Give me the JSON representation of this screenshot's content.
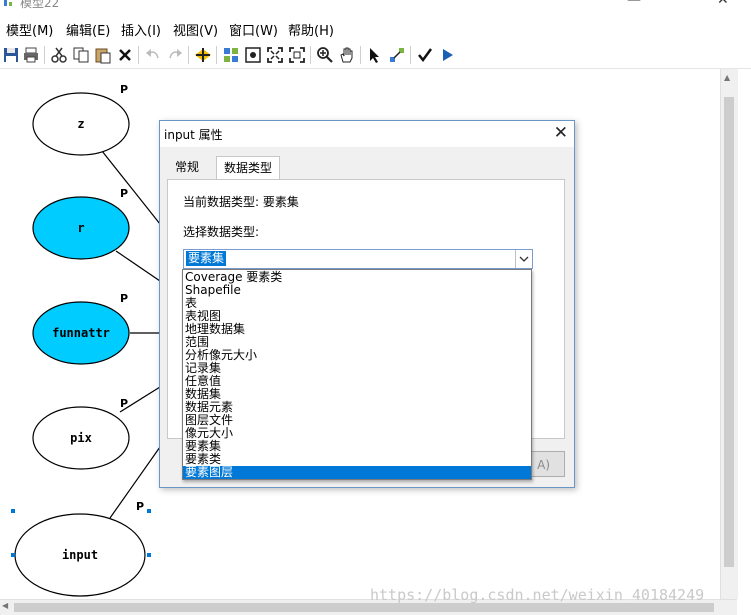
{
  "window": {
    "title": "模型22"
  },
  "menu": [
    {
      "label": "模型(M)"
    },
    {
      "label": "编辑(E)"
    },
    {
      "label": "插入(I)"
    },
    {
      "label": "视图(V)"
    },
    {
      "label": "窗口(W)"
    },
    {
      "label": "帮助(H)"
    }
  ],
  "toolbar_icons": [
    "save-icon",
    "print-icon",
    "cut-icon",
    "copy-icon",
    "paste-icon",
    "delete-icon",
    "undo-icon",
    "redo-icon",
    "add-data-icon",
    "auto-layout-icon",
    "full-extent-icon",
    "zoom-fit-icon",
    "zoom-extent-icon",
    "zoom-in-icon",
    "pan-icon",
    "select-icon",
    "connect-icon",
    "validate-icon",
    "run-icon"
  ],
  "model": {
    "nodes": [
      {
        "id": "z",
        "label": "z",
        "param": "P",
        "fill": "#ffffff"
      },
      {
        "id": "r",
        "label": "r",
        "param": "P",
        "fill": "#00ccff"
      },
      {
        "id": "funnattr",
        "label": "funnattr",
        "param": "P",
        "fill": "#00ccff"
      },
      {
        "id": "pix",
        "label": "pix",
        "param": "P",
        "fill": "#ffffff"
      },
      {
        "id": "input",
        "label": "input",
        "param": "P",
        "fill": "#ffffff"
      }
    ]
  },
  "dialog": {
    "title": "input 属性",
    "tabs": [
      {
        "label": "常规"
      },
      {
        "label": "数据类型"
      }
    ],
    "current_type_label": "当前数据类型: 要素集",
    "select_type_label": "选择数据类型:",
    "selected_value": "要素集",
    "options": [
      "Coverage 要素类",
      "Shapefile",
      "表",
      "表视图",
      "地理数据集",
      "范围",
      "分析像元大小",
      "记录集",
      "任意值",
      "数据集",
      "数据元素",
      "图层文件",
      "像元大小",
      "要素集",
      "要素类",
      "要素图层"
    ],
    "highlighted_option": "要素图层",
    "apply_label": "A)"
  },
  "watermark": "https://blog.csdn.net/weixin_40184249",
  "colors": {
    "accent": "#0078d7",
    "node_highlight": "#00ccff"
  }
}
